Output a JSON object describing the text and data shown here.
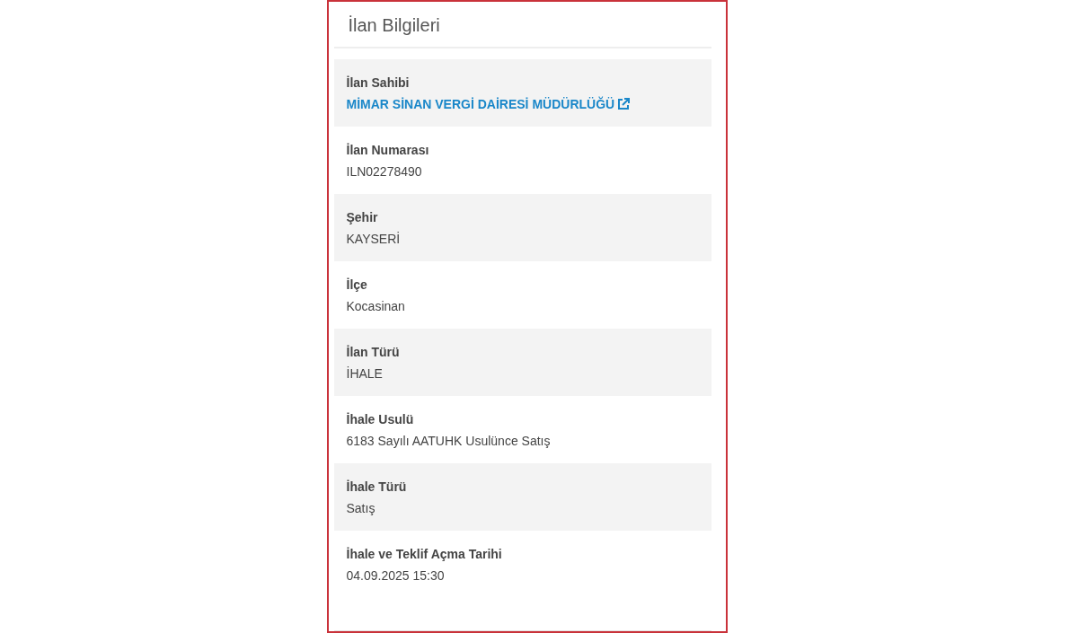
{
  "panel": {
    "title": "İlan Bilgileri"
  },
  "fields": [
    {
      "label": "İlan Sahibi",
      "value": "MİMAR SİNAN VERGİ DAİRESİ MÜDÜRLÜĞÜ",
      "kind": "link"
    },
    {
      "label": "İlan Numarası",
      "value": "ILN02278490",
      "kind": "text"
    },
    {
      "label": "Şehir",
      "value": "KAYSERİ",
      "kind": "text"
    },
    {
      "label": "İlçe",
      "value": "Kocasinan",
      "kind": "text"
    },
    {
      "label": "İlan Türü",
      "value": "İHALE",
      "kind": "text"
    },
    {
      "label": "İhale Usulü",
      "value": "6183 Sayılı AATUHK Usulünce Satış",
      "kind": "text"
    },
    {
      "label": "İhale Türü",
      "value": "Satış",
      "kind": "text"
    },
    {
      "label": "İhale ve Teklif Açma Tarihi",
      "value": "04.09.2025 15:30",
      "kind": "text"
    }
  ]
}
